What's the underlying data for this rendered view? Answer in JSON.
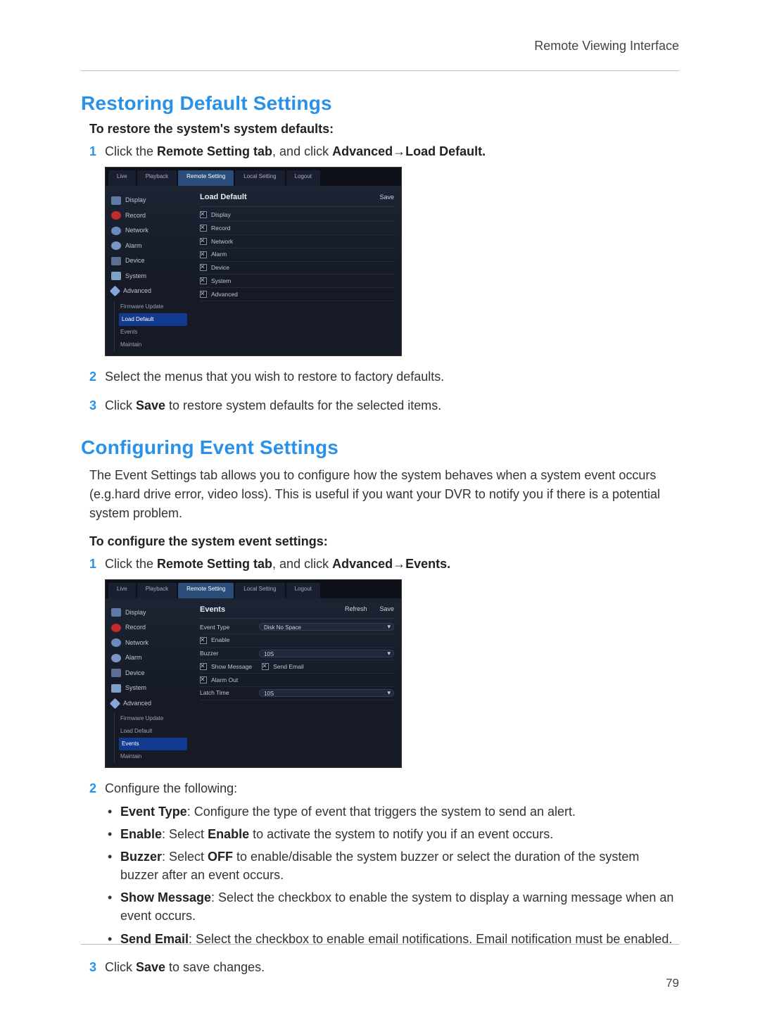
{
  "header": {
    "right": "Remote Viewing Interface"
  },
  "page_number": "79",
  "sections": {
    "restore": {
      "title": "Restoring Default Settings",
      "subhead": "To restore the system's system defaults:",
      "step1": {
        "pre": "Click the ",
        "bold1": "Remote Setting tab",
        "mid": ", and click ",
        "bold2": "Advanced",
        "arrow": "→",
        "bold3": "Load Default."
      },
      "step2": "Select the menus that you wish to restore to factory defaults.",
      "step3": {
        "pre": "Click ",
        "bold": "Save",
        "post": " to restore system defaults for the selected items."
      }
    },
    "events": {
      "title": "Configuring Event Settings",
      "intro": "The Event Settings tab allows you to configure how the system behaves when a system event occurs (e.g.hard drive error, video loss). This is useful if you want your DVR to notify you if there is a potential system problem.",
      "subhead": "To configure the system event settings:",
      "step1": {
        "pre": "Click the ",
        "bold1": "Remote Setting tab",
        "mid": ", and click ",
        "bold2": "Advanced",
        "arrow": "→",
        "bold3": "Events."
      },
      "step2_intro": "Configure the following:",
      "bullets": {
        "event_type": {
          "label": "Event Type",
          "text": ": Configure the type of event that triggers the system to send an alert."
        },
        "enable": {
          "label": "Enable",
          "pre": ": Select ",
          "bold": "Enable",
          "post": " to activate the system to notify you if an event occurs."
        },
        "buzzer": {
          "label": "Buzzer",
          "pre": ": Select ",
          "bold": "OFF",
          "post": " to enable/disable the system buzzer or select the duration of the system buzzer after an event occurs."
        },
        "show_msg": {
          "label": "Show Message",
          "text": ": Select the checkbox to enable the system to display a warning message when an event occurs."
        },
        "send_email": {
          "label": "Send Email",
          "text": ": Select the checkbox to enable email notifications. Email notification must be enabled."
        }
      },
      "step3": {
        "pre": "Click ",
        "bold": "Save",
        "post": " to save changes."
      }
    }
  },
  "shot_common": {
    "tabs": {
      "live": "Live",
      "playback": "Playback",
      "remote": "Remote Setting",
      "local": "Local Setting",
      "logout": "Logout"
    },
    "sidebar": {
      "display": "Display",
      "record": "Record",
      "network": "Network",
      "alarm": "Alarm",
      "device": "Device",
      "system": "System",
      "advanced": "Advanced",
      "sub_fw": "Firmware Update",
      "sub_load": "Load Default",
      "sub_events": "Events",
      "sub_maint": "Maintain"
    }
  },
  "shot1": {
    "panel_title": "Load Default",
    "action_save": "Save",
    "rows": {
      "display": "Display",
      "record": "Record",
      "network": "Network",
      "alarm": "Alarm",
      "device": "Device",
      "system": "System",
      "advanced": "Advanced"
    }
  },
  "shot2": {
    "panel_title": "Events",
    "action_refresh": "Refresh",
    "action_save": "Save",
    "rows": {
      "event_type": "Event Type",
      "event_type_val": "Disk No Space",
      "enable": "Enable",
      "buzzer": "Buzzer",
      "buzzer_val": "10S",
      "show_message": "Show Message",
      "send_email": "Send Email",
      "alarm_out": "Alarm Out",
      "latch_time": "Latch Time",
      "latch_time_val": "10S"
    }
  }
}
